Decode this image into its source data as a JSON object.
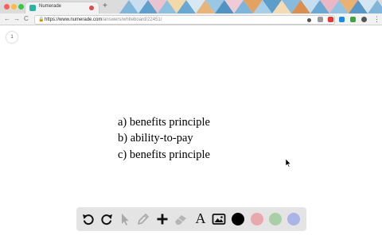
{
  "browser": {
    "tab": {
      "title": "Numerade"
    },
    "new_tab_label": "+",
    "nav": {
      "back": "←",
      "forward": "→",
      "reload": "C"
    },
    "address": {
      "host": "https://www.numerade.com",
      "path": "/answers/whiteboard/22451/"
    },
    "menu_label": "⋮"
  },
  "whiteboard": {
    "page_number": "1",
    "answers": [
      "a) benefits principle",
      "b) ability-to-pay",
      "c) benefits principle"
    ]
  },
  "toolbar": {
    "text_tool_label": "A",
    "tools": [
      "undo-icon",
      "redo-icon",
      "pointer-icon",
      "pencil-icon",
      "add-icon",
      "eraser-icon",
      "text-icon",
      "image-icon"
    ],
    "colors": [
      "#000000",
      "#e8a8ad",
      "#a9cfa7",
      "#aab4e6"
    ]
  }
}
